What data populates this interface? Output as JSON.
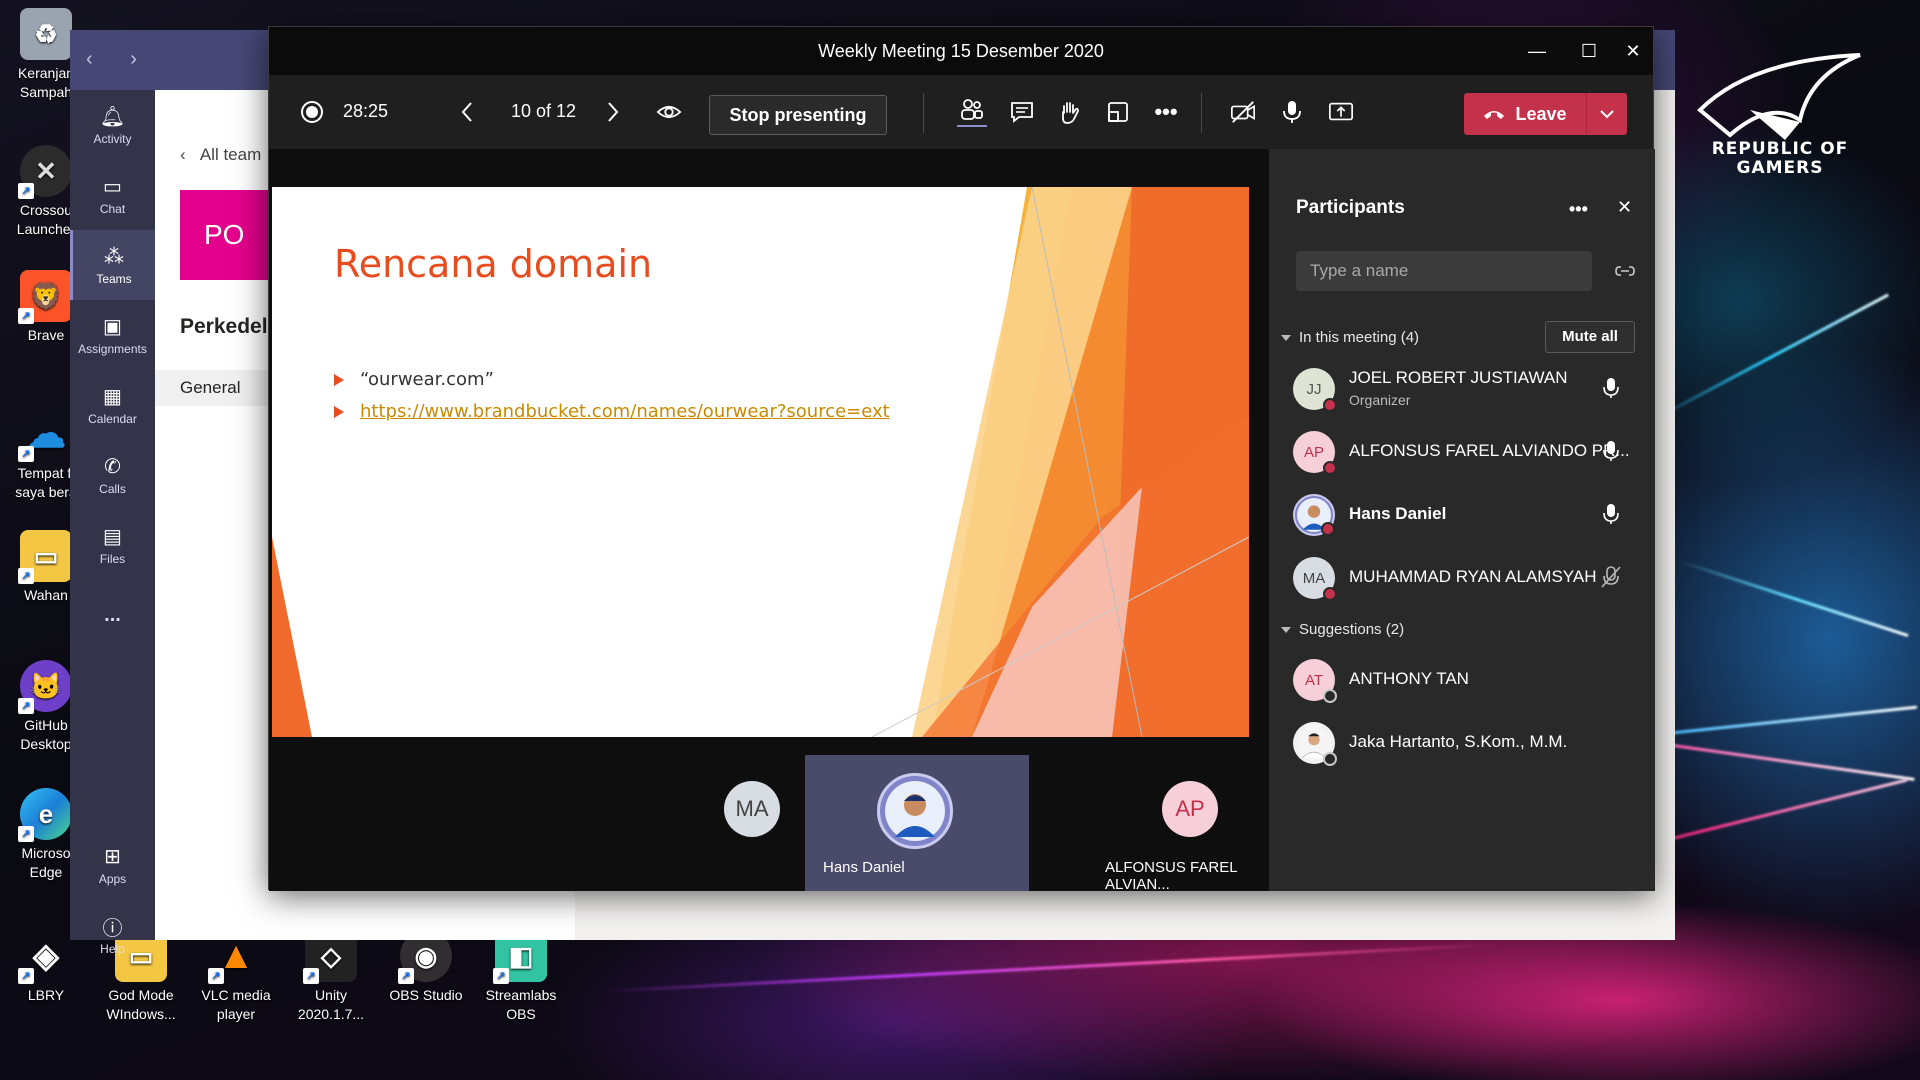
{
  "desktop": {
    "icons": [
      {
        "label": "Keranjan\nSampah",
        "short": "Keranjan",
        "short2": "Sampah"
      },
      {
        "label": "Crossou\nLauncher",
        "short": "Crossou",
        "short2": "Launcher"
      },
      {
        "label": "Brave",
        "short": "Brave",
        "short2": ""
      },
      {
        "label": "Tempat fi\nsaya bera",
        "short": "Tempat fi",
        "short2": "saya bera"
      },
      {
        "label": "Wahan",
        "short": "Wahan",
        "short2": ""
      },
      {
        "label": "GitHub\nDesktop",
        "short": "GitHub",
        "short2": "Desktop"
      },
      {
        "label": "Microso\nEdge",
        "short": "Microso",
        "short2": "Edge"
      }
    ],
    "bottom_icons": [
      {
        "l1": "LBRY",
        "l2": ""
      },
      {
        "l1": "God Mode",
        "l2": "WIndows..."
      },
      {
        "l1": "VLC media",
        "l2": "player"
      },
      {
        "l1": "Unity",
        "l2": "2020.1.7..."
      },
      {
        "l1": "OBS Studio",
        "l2": ""
      },
      {
        "l1": "Streamlabs",
        "l2": "OBS"
      }
    ],
    "brand": {
      "line1": "REPUBLIC OF",
      "line2": "GAMERS"
    }
  },
  "teams_bg": {
    "rail": [
      {
        "label": "Activity",
        "icon": "bell-icon"
      },
      {
        "label": "Chat",
        "icon": "chat-icon"
      },
      {
        "label": "Teams",
        "icon": "teams-icon",
        "active": true
      },
      {
        "label": "Assignments",
        "icon": "assignments-icon"
      },
      {
        "label": "Calendar",
        "icon": "calendar-icon"
      },
      {
        "label": "Calls",
        "icon": "phone-icon"
      },
      {
        "label": "Files",
        "icon": "files-icon"
      }
    ],
    "more": "...",
    "apps": "Apps",
    "help": "Help",
    "all_teams": "All team",
    "team_tile": "PO",
    "team_name": "Perkedel",
    "channel": "General"
  },
  "meeting": {
    "title": "Weekly Meeting 15 Desember 2020",
    "timer": "28:25",
    "slide_counter": "10 of 12",
    "stop_presenting": "Stop presenting",
    "leave": "Leave",
    "slide": {
      "title": "Rencana domain",
      "bullets": [
        "“ourwear.com”",
        "https://www.brandbucket.com/names/ourwear?source=ext"
      ]
    },
    "tiles": [
      {
        "initials": "MA",
        "name": ""
      },
      {
        "initials": "",
        "name": "Hans Daniel"
      },
      {
        "initials": "AP",
        "name": "ALFONSUS FAREL ALVIAN..."
      }
    ]
  },
  "participants": {
    "header": "Participants",
    "search_placeholder": "Type a name",
    "in_meeting": "In this meeting (4)",
    "mute_all": "Mute all",
    "members": [
      {
        "initials": "JJ",
        "name": "JOEL ROBERT JUSTIAWAN",
        "role": "Organizer",
        "mic": "on"
      },
      {
        "initials": "AP",
        "name": "ALFONSUS FAREL ALVIANDO PR...",
        "role": "",
        "mic": "on"
      },
      {
        "initials": "",
        "name": "Hans Daniel",
        "role": "",
        "mic": "on"
      },
      {
        "initials": "MA",
        "name": "MUHAMMAD RYAN ALAMSYAH",
        "role": "",
        "mic": "muted"
      }
    ],
    "suggestions_header": "Suggestions (2)",
    "suggestions": [
      {
        "initials": "AT",
        "name": "ANTHONY TAN"
      },
      {
        "initials": "",
        "name": "Jaka Hartanto, S.Kom., M.M."
      }
    ]
  },
  "colors": {
    "teams_purple": "#464775",
    "leave_red": "#c4314b",
    "slide_accent": "#e84c1e",
    "tile_pink": "#e3008c"
  }
}
